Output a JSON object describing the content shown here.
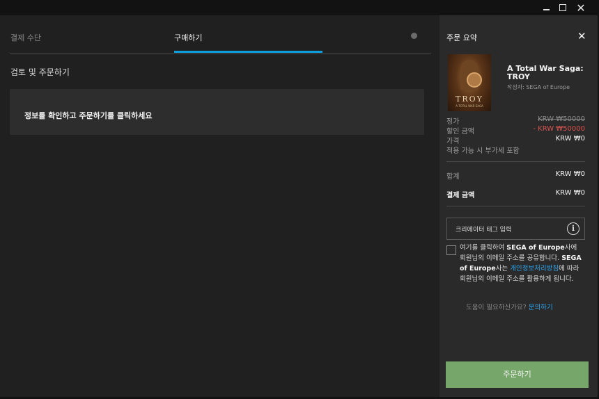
{
  "window": {
    "minimize": "",
    "maximize": "",
    "close": "✕"
  },
  "tabs": {
    "payment": "결제 수단",
    "purchase": "구매하기"
  },
  "review": {
    "title": "검토 및 주문하기",
    "notice": "정보를 확인하고 주문하기를 클릭하세요"
  },
  "summary": {
    "title": "주문 요약",
    "close": "✕",
    "game": {
      "title": "A Total War Saga: TROY",
      "publisher": "작성자: SEGA of Europe",
      "cover_title": "TROY",
      "cover_subtitle": "A TOTAL WAR SAGA"
    },
    "price_rows": [
      {
        "label": "정가",
        "value": "KRW ₩50000"
      },
      {
        "label": "할인 금액",
        "value": "- KRW ₩50000"
      },
      {
        "label": "가격",
        "value": "KRW ₩0"
      },
      {
        "label": "적용 가능 시 부가세 포함",
        "value": ""
      }
    ],
    "total": {
      "label": "합계",
      "value": "KRW ₩0"
    },
    "payment_amount": {
      "label": "결제 금액",
      "value": "KRW ₩0"
    },
    "creator_tag_placeholder": "크리에이터 태그 입력",
    "info_icon": "i",
    "consent": {
      "part1": "여기를 클릭하여 ",
      "publisher1": "SEGA of Europe",
      "part2": "사에 회원님의 이메일 주소를 공유합니다. ",
      "publisher2": "SEGA of Europe",
      "part3": "사는 ",
      "policy_link": "개인정보처리방침",
      "part4": "에 따라 회원님의 이메일 주소를 활용하게 됩니다."
    },
    "help": {
      "question": "도움이 필요하신가요? ",
      "link": "문의하기"
    },
    "order_button": "주문하기"
  },
  "colors": {
    "accent_blue": "#0d9edd",
    "order_green": "#77a66a",
    "discount_red": "#d9534f"
  }
}
